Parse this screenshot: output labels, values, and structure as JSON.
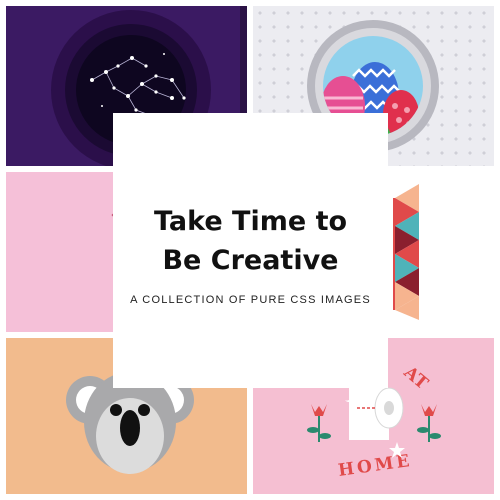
{
  "card": {
    "title_line1": "Take Time to",
    "title_line2": "Be Creative",
    "subtitle": "A COLLECTION OF PURE CSS IMAGES"
  },
  "tiles": [
    {
      "id": "constellation",
      "icon": "constellation-porthole-icon",
      "background": "#3b1a63"
    },
    {
      "id": "easter-eggs",
      "icon": "easter-eggs-porthole-icon",
      "background": "#ececf1"
    },
    {
      "id": "pink-blank",
      "background": "#f5c0d8"
    },
    {
      "id": "triangles",
      "icon": "triangle-pattern-icon",
      "background": "#ffffff"
    },
    {
      "id": "koala",
      "icon": "koala-face-icon",
      "background": "#f2bb8d"
    },
    {
      "id": "at-home",
      "icon": "toilet-paper-icon",
      "background": "#f5bfd2"
    }
  ],
  "at_home": {
    "word_top": "AT",
    "word_bottom": "HOME"
  },
  "colors": {
    "accent_red": "#e04a4a",
    "teal": "#4fb3b9",
    "maroon": "#8a1f2e",
    "peach": "#f6b48f"
  }
}
